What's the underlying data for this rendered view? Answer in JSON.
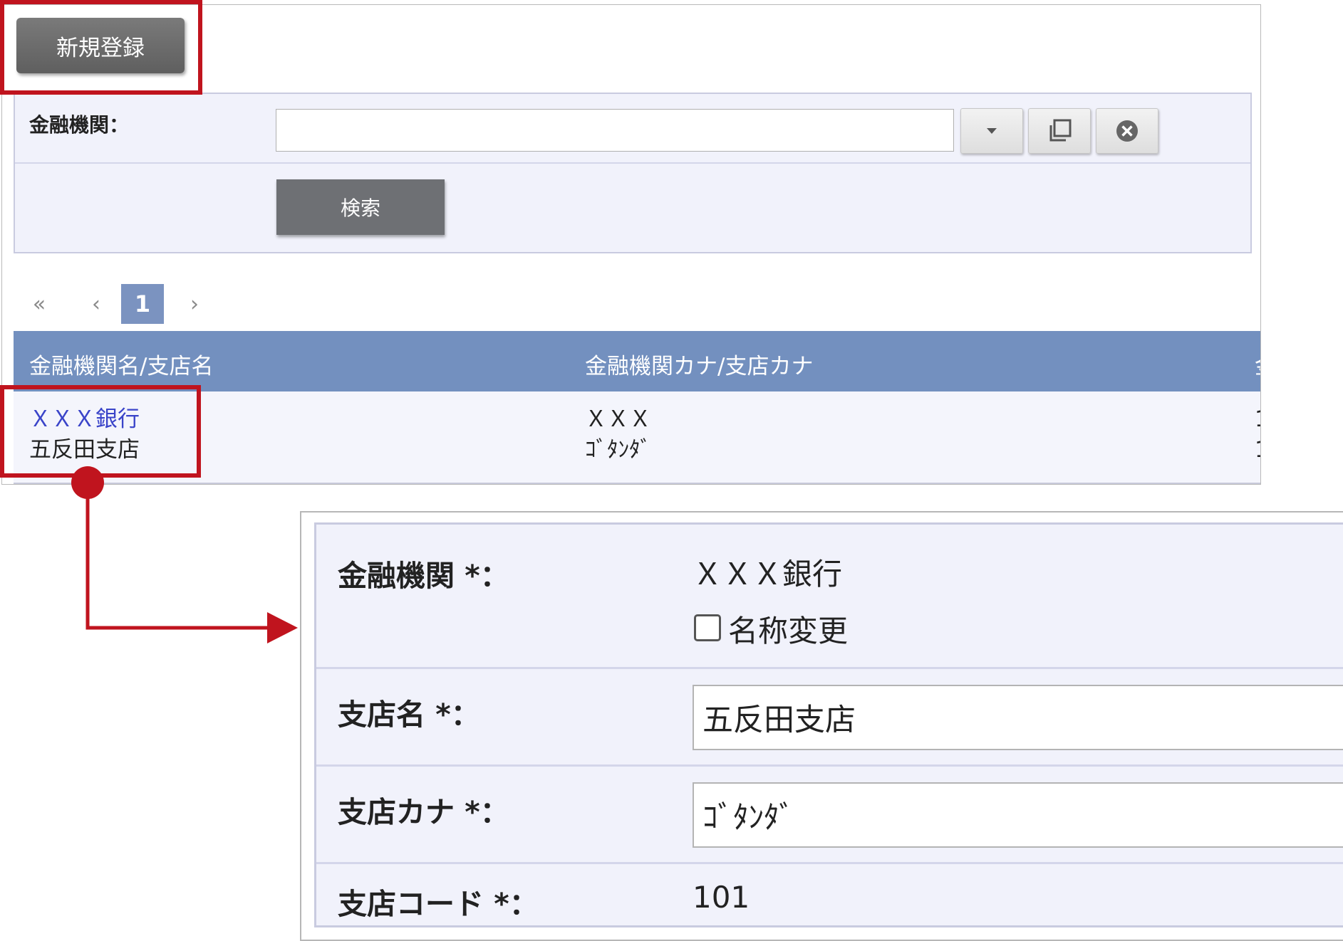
{
  "top": {
    "new_button_label": "新規登録",
    "search": {
      "label": "金融機関：",
      "input_value": "",
      "buttons": [
        {
          "icon": "dropdown-arrow-icon"
        },
        {
          "icon": "copy-icon"
        },
        {
          "icon": "clear-circle-icon"
        }
      ],
      "search_button_label": "検索"
    },
    "pagination": {
      "first": "«",
      "prev": "‹",
      "current": "1",
      "next": "›"
    },
    "results": {
      "columns": [
        "金融機関名/支店名",
        "金融機関カナ/支店カナ",
        "金"
      ],
      "rows": [
        {
          "bank_name": "ＸＸＸ銀行",
          "branch_name": "五反田支店",
          "bank_kana": "ＸＸＸ",
          "branch_kana": "ｺﾞﾀﾝﾀﾞ",
          "col3_line1": "1",
          "col3_line2": "1"
        }
      ]
    }
  },
  "detail": {
    "bank": {
      "label": "金融機関 *：",
      "value": "ＸＸＸ銀行",
      "rename_checkbox_label": "名称変更",
      "rename_checked": false
    },
    "branch_name": {
      "label": "支店名 *：",
      "value": "五反田支店"
    },
    "branch_kana": {
      "label": "支店カナ *：",
      "value": "ｺﾞﾀﾝﾀﾞ"
    },
    "branch_code": {
      "label": "支店コード *：",
      "value": "101"
    }
  },
  "colors": {
    "highlight": "#c0141e",
    "header_bg": "#7390bf",
    "link": "#3a44c9",
    "form_bg": "#f1f2fb"
  }
}
